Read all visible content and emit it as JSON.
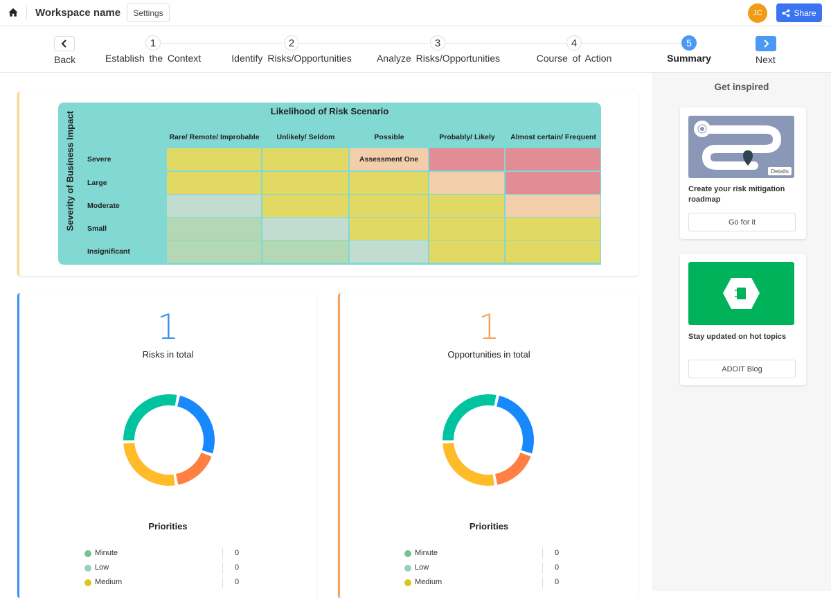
{
  "topbar": {
    "home_icon": "home-icon",
    "workspace_name": "Workspace name",
    "settings_label": "Settings",
    "avatar_initials": "JC",
    "share_label": "Share",
    "share_icon": "share-icon"
  },
  "stepper": {
    "back_label": "Back",
    "next_label": "Next",
    "steps": [
      {
        "number": "1",
        "label": "Establish the Context",
        "active": false
      },
      {
        "number": "2",
        "label": "Identify Risks/Opportunities",
        "active": false
      },
      {
        "number": "3",
        "label": "Analyze Risks/Opportunities",
        "active": false
      },
      {
        "number": "4",
        "label": "Course of Action",
        "active": false
      },
      {
        "number": "5",
        "label": "Summary",
        "active": true
      }
    ]
  },
  "matrix": {
    "title": "Likelihood of Risk Scenario",
    "y_axis_label": "Severity of Business Impact",
    "columns": [
      "Rare/ Remote/ Improbable",
      "Unlikely/ Seldom",
      "Possible",
      "Probably/ Likely",
      "Almost certain/ Frequent"
    ],
    "rows": [
      "Severe",
      "Large",
      "Moderate",
      "Small",
      "Insignificant"
    ],
    "colors": {
      "yellow": "#e2d964",
      "red": "#e28c95",
      "peach": "#f2cfaa",
      "lightgreen": "#c2ddd0",
      "green": "#b3d8b3"
    },
    "cells": [
      [
        {
          "c": "yellow",
          "t": ""
        },
        {
          "c": "yellow",
          "t": ""
        },
        {
          "c": "peach",
          "t": "Assessment One"
        },
        {
          "c": "red",
          "t": ""
        },
        {
          "c": "red",
          "t": ""
        }
      ],
      [
        {
          "c": "yellow",
          "t": ""
        },
        {
          "c": "yellow",
          "t": ""
        },
        {
          "c": "yellow",
          "t": ""
        },
        {
          "c": "peach",
          "t": ""
        },
        {
          "c": "red",
          "t": ""
        }
      ],
      [
        {
          "c": "lightgreen",
          "t": ""
        },
        {
          "c": "yellow",
          "t": ""
        },
        {
          "c": "yellow",
          "t": ""
        },
        {
          "c": "yellow",
          "t": ""
        },
        {
          "c": "peach",
          "t": ""
        }
      ],
      [
        {
          "c": "green",
          "t": ""
        },
        {
          "c": "lightgreen",
          "t": ""
        },
        {
          "c": "yellow",
          "t": ""
        },
        {
          "c": "yellow",
          "t": ""
        },
        {
          "c": "yellow",
          "t": ""
        }
      ],
      [
        {
          "c": "green",
          "t": ""
        },
        {
          "c": "green",
          "t": ""
        },
        {
          "c": "lightgreen",
          "t": ""
        },
        {
          "c": "yellow",
          "t": ""
        },
        {
          "c": "yellow",
          "t": ""
        }
      ]
    ]
  },
  "risks": {
    "total": "1",
    "label": "Risks in total",
    "accent": "#3b8ff0",
    "priorities_title": "Priorities",
    "priorities": [
      {
        "name": "Minute",
        "value": "0",
        "color": "#7cc08c"
      },
      {
        "name": "Low",
        "value": "0",
        "color": "#9fcfb4"
      },
      {
        "name": "Medium",
        "value": "0",
        "color": "#d8c81a"
      }
    ]
  },
  "opportunities": {
    "total": "1",
    "label": "Opportunities in total",
    "accent": "#f7a35b",
    "priorities_title": "Priorities",
    "priorities": [
      {
        "name": "Minute",
        "value": "0",
        "color": "#7cc08c"
      },
      {
        "name": "Low",
        "value": "0",
        "color": "#9fcfb4"
      },
      {
        "name": "Medium",
        "value": "0",
        "color": "#d8c81a"
      }
    ]
  },
  "donut": {
    "segments": [
      {
        "name": "blue",
        "color": "#1789fc",
        "fraction": 0.27
      },
      {
        "name": "orange",
        "color": "#ff8042",
        "fraction": 0.17
      },
      {
        "name": "yellow",
        "color": "#ffbb28",
        "fraction": 0.27
      },
      {
        "name": "green",
        "color": "#00c49f",
        "fraction": 0.29
      }
    ]
  },
  "sidebar": {
    "title": "Get inspired",
    "cards": [
      {
        "text": "Create your risk mitigation roadmap",
        "button": "Go for it",
        "image_tag": "Details",
        "image_icon": "roadmap-illustration"
      },
      {
        "text": "Stay updated on hot topics",
        "button": "ADOIT Blog",
        "image_icon": "blog-notebook-icon"
      }
    ]
  }
}
